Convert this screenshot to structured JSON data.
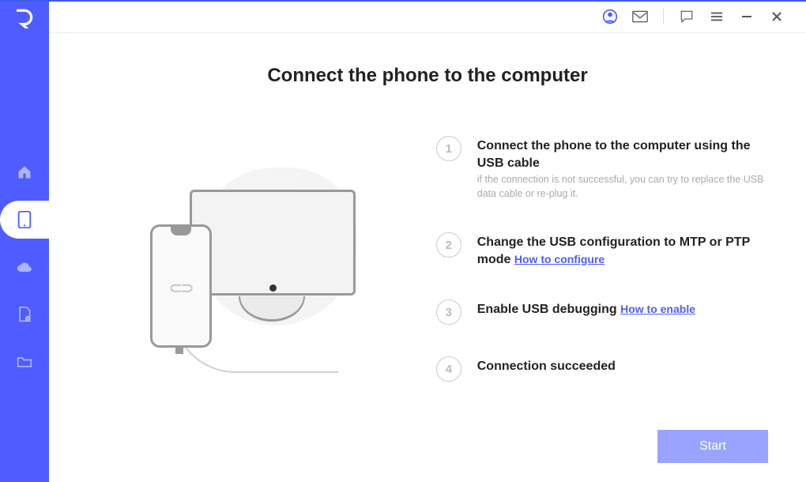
{
  "page": {
    "title": "Connect the phone to the computer"
  },
  "sidebar": {
    "items": [
      {
        "name": "home"
      },
      {
        "name": "phone",
        "active": true
      },
      {
        "name": "cloud"
      },
      {
        "name": "file-alert"
      },
      {
        "name": "folder"
      }
    ]
  },
  "steps": [
    {
      "num": "1",
      "title": "Connect the phone to the computer using the USB cable",
      "sub": "if the connection is not successful, you can try to replace the USB data cable or re-plug it."
    },
    {
      "num": "2",
      "title": "Change the USB configuration to MTP or PTP mode",
      "link": "How to configure"
    },
    {
      "num": "3",
      "title": "Enable USB debugging",
      "link": "How to enable"
    },
    {
      "num": "4",
      "title": "Connection succeeded"
    }
  ],
  "actions": {
    "start": "Start"
  }
}
